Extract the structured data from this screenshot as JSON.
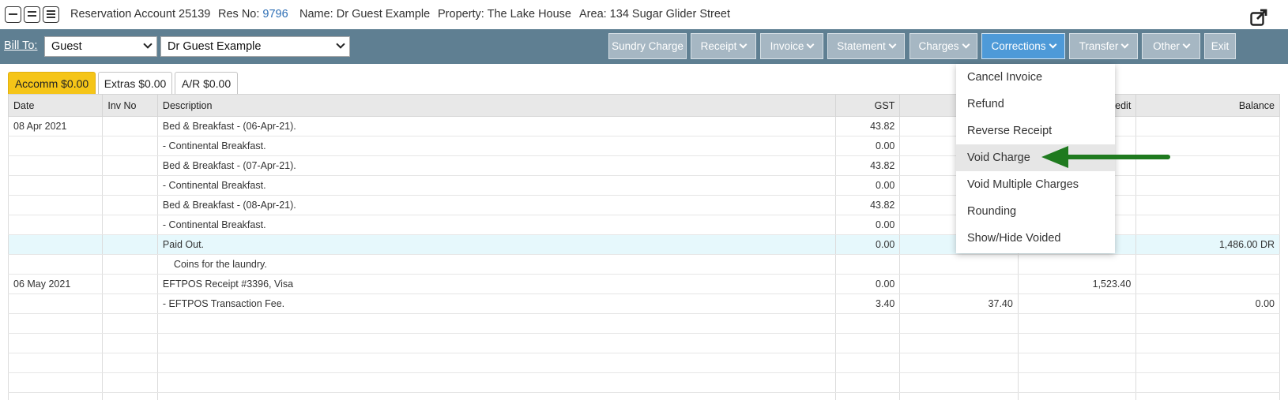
{
  "header": {
    "account_label": "Reservation Account 25139",
    "res_no_label": "Res No:",
    "res_no_value": "9796",
    "name": "Name: Dr Guest Example",
    "property": "Property: The Lake House",
    "area": "Area: 134 Sugar Glider Street"
  },
  "toolbar": {
    "bill_to_label": "Bill To:",
    "bill_to_type": "Guest",
    "bill_to_name": "Dr Guest Example",
    "buttons": {
      "sundry": "Sundry Charge",
      "receipt": "Receipt",
      "invoice": "Invoice",
      "statement": "Statement",
      "charges": "Charges",
      "corrections": "Corrections",
      "transfer": "Transfer",
      "other": "Other",
      "exit": "Exit"
    }
  },
  "tabs": [
    "Accomm $0.00",
    "Extras $0.00",
    "A/R $0.00"
  ],
  "table": {
    "columns": [
      "Date",
      "Inv No",
      "Description",
      "GST",
      "",
      "edit",
      "Balance"
    ],
    "rows": [
      {
        "date": "08 Apr 2021",
        "inv": "",
        "desc": "Bed & Breakfast - (06-Apr-21).",
        "gst": "43.82",
        "debit": "",
        "credit": "",
        "balance": ""
      },
      {
        "date": "",
        "inv": "",
        "desc": "- Continental Breakfast.",
        "gst": "0.00",
        "debit": "",
        "credit": "",
        "balance": ""
      },
      {
        "date": "",
        "inv": "",
        "desc": "Bed & Breakfast - (07-Apr-21).",
        "gst": "43.82",
        "debit": "",
        "credit": "",
        "balance": ""
      },
      {
        "date": "",
        "inv": "",
        "desc": "- Continental Breakfast.",
        "gst": "0.00",
        "debit": "",
        "credit": "",
        "balance": ""
      },
      {
        "date": "",
        "inv": "",
        "desc": "Bed & Breakfast - (08-Apr-21).",
        "gst": "43.82",
        "debit": "",
        "credit": "",
        "balance": ""
      },
      {
        "date": "",
        "inv": "",
        "desc": "- Continental Breakfast.",
        "gst": "0.00",
        "debit": "",
        "credit": "",
        "balance": ""
      },
      {
        "date": "",
        "inv": "",
        "desc": "Paid Out.",
        "gst": "0.00",
        "debit": "",
        "credit": "",
        "balance": "1,486.00 DR"
      },
      {
        "date": "",
        "inv": "",
        "desc": "Coins for the laundry.",
        "gst": "",
        "debit": "",
        "credit": "",
        "balance": ""
      },
      {
        "date": "06 May 2021",
        "inv": "",
        "desc": "EFTPOS Receipt #3396, Visa",
        "gst": "0.00",
        "debit": "",
        "credit": "1,523.40",
        "balance": ""
      },
      {
        "date": "",
        "inv": "",
        "desc": "- EFTPOS Transaction Fee.",
        "gst": "3.40",
        "debit": "37.40",
        "credit": "",
        "balance": "0.00"
      }
    ]
  },
  "corrections_menu": [
    "Cancel Invoice",
    "Refund",
    "Reverse Receipt",
    "Void Charge",
    "Void Multiple Charges",
    "Rounding",
    "Show/Hide Voided"
  ],
  "colors": {
    "toolbar_bg": "#5f7f92",
    "button_bg": "#a6b7c3",
    "active_button": "#4e9ad8",
    "active_tab": "#f5c518",
    "highlight_row": "#e6f8fc",
    "receipt_green": "#2e8b2e",
    "link_blue": "#2e6fb5",
    "arrow_green": "#1f7a1f"
  },
  "icons": [
    "single-line-view-icon",
    "double-line-view-icon",
    "multi-line-view-icon",
    "external-link-icon",
    "chevron-down-icon",
    "arrow-pointer-icon"
  ]
}
